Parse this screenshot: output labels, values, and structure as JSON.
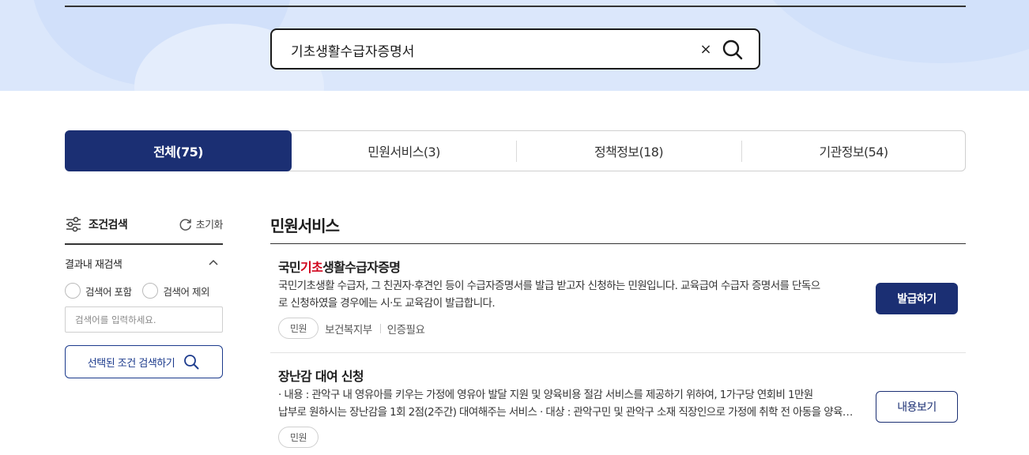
{
  "search": {
    "query": "기초생활수급자증명서",
    "clear_label": "×"
  },
  "tabs": [
    {
      "label": "전체(75)",
      "active": true
    },
    {
      "label": "민원서비스(3)",
      "active": false
    },
    {
      "label": "정책정보(18)",
      "active": false
    },
    {
      "label": "기관정보(54)",
      "active": false
    }
  ],
  "sidebar": {
    "title": "조건검색",
    "reset_label": "초기화",
    "research_title": "결과내 재검색",
    "include_label": "검색어 포함",
    "exclude_label": "검색어 제외",
    "input_placeholder": "검색어를 입력하세요.",
    "search_button_label": "선택된 조건 검색하기"
  },
  "main": {
    "section_title": "민원서비스",
    "items": [
      {
        "title_pre": "국민",
        "title_highlight": "기초",
        "title_post": "생활수급자증명",
        "desc_line1": "국민기초생활 수급자, 그 친권자·후견인 등이 수급자증명서를 발급 받고자 신청하는 민원입니다. 교육급여 수급자 증명서를 단독으",
        "desc_line2": "로 신청하였을 경우에는 시·도 교육감이 발급합니다.",
        "chip": "민원",
        "agency": "보건복지부",
        "tag": "인증필요",
        "button": "발급하기"
      },
      {
        "title": "장난감 대여 신청",
        "desc_line1": "· 내용 : 관악구 내 영유아를 키우는 가정에 영유아 발달 지원 및 양육비용 절감 서비스를 제공하기 위하여, 1가구당 연회비 1만원",
        "desc_line2": "납부로 원하시는 장난감을 1회 2점(2주간) 대여해주는 서비스 · 대상 : 관악구민 및 관악구 소재 직장인으로 가정에 취학 전 아동을 양육하는",
        "chip": "민원",
        "button": "내용보기"
      }
    ]
  },
  "colors": {
    "primary": "#1b2f73",
    "highlight": "#d0021b",
    "hero_bg": "#dbe7fb"
  }
}
